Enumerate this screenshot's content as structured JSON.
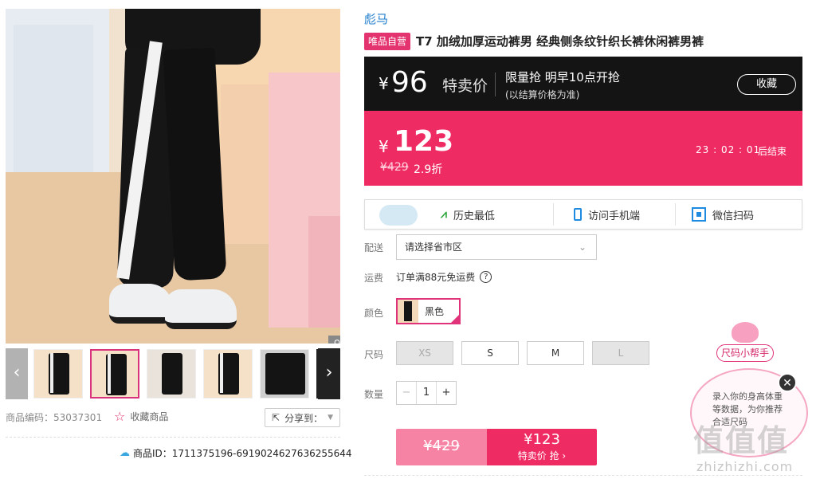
{
  "gallery": {
    "zoom_icon": "magnifier-icon",
    "prev_label": "‹",
    "next_label": "›",
    "thumb_count": 6
  },
  "meta": {
    "product_code": "商品编码：53037301",
    "favorite": "收藏商品",
    "share": "分享到：",
    "product_id": "商品ID：1711375196-6919024627636255644"
  },
  "brand": "彪马",
  "tag": "唯品自营",
  "title": "T7 加绒加厚运动裤男 经典侧条纹针织长裤休闲裤男裤",
  "special": {
    "yen": "¥",
    "price": "96",
    "label": "特卖价",
    "line1": "限量抢 明早10点开抢",
    "line2": "(以结算价格为准)",
    "fav": "收藏"
  },
  "current": {
    "yen": "¥",
    "price": "123",
    "original": "¥429",
    "discount": "2.9折",
    "countdown": "23 : 02 : 01",
    "ends": "后结束"
  },
  "services": {
    "history": "历史最低",
    "mobile": "访问手机端",
    "wechat": "微信扫码"
  },
  "labels": {
    "delivery": "配送",
    "shipping": "运费",
    "color": "颜色",
    "size": "尺码",
    "qty": "数量"
  },
  "delivery_select": "请选择省市区",
  "shipping_text": "订单满88元免运费",
  "color_option": "黑色",
  "sizes": [
    "XS",
    "S",
    "M",
    "L"
  ],
  "qty": {
    "minus": "−",
    "value": "1",
    "plus": "+"
  },
  "buy": {
    "original": "¥429",
    "price": "¥123",
    "action": "特卖价 抢 ›"
  },
  "helper": {
    "button": "尺码小帮手",
    "text": "录入你的身高体重等数据，为你推荐合适尺码",
    "close": "✕"
  },
  "watermark": {
    "big": "值值值",
    "url": "zhizhizhi.com"
  }
}
